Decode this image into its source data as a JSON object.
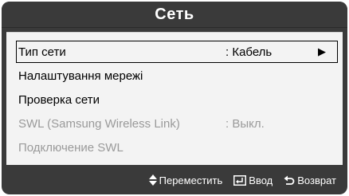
{
  "window": {
    "title": "Сеть"
  },
  "menu": {
    "items": [
      {
        "label": "Тип сети",
        "value": ": Кабель",
        "arrow": "▶"
      },
      {
        "label": "Налаштування мережі"
      },
      {
        "label": "Проверка сети"
      },
      {
        "label": "SWL (Samsung Wireless Link)",
        "value": ": Выкл."
      },
      {
        "label": "Подключение SWL"
      }
    ]
  },
  "footer": {
    "move_label": "Переместить",
    "enter_label": "Ввод",
    "back_label": "Возврат"
  },
  "colors": {
    "window_bg": "#3a3a3a",
    "panel_bg": "#f3f3f3",
    "disabled_text": "#9a9a9a",
    "title_text": "#ffffff"
  }
}
